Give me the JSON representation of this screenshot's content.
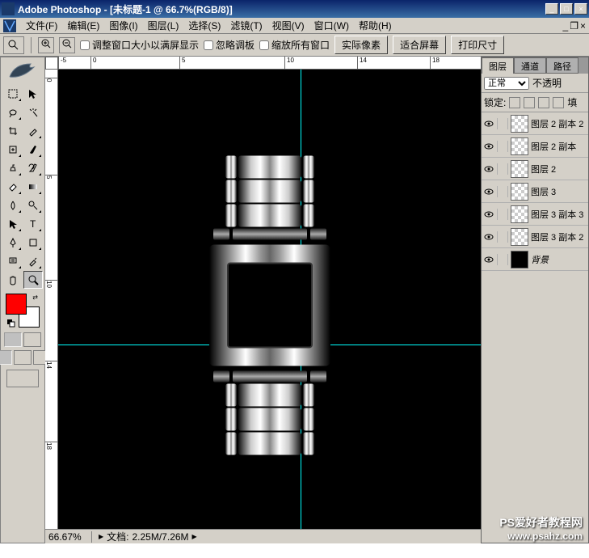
{
  "titlebar": {
    "app_name": "Adobe Photoshop",
    "doc_title": "[未标题-1 @ 66.7%(RGB/8)]",
    "separator": " - "
  },
  "menu": {
    "items": [
      "文件(F)",
      "编辑(E)",
      "图像(I)",
      "图层(L)",
      "选择(S)",
      "滤镜(T)",
      "视图(V)",
      "窗口(W)",
      "帮助(H)"
    ]
  },
  "optionbar": {
    "resize_windows": "调整窗口大小以满屏显示",
    "ignore_palettes": "忽略调板",
    "zoom_all": "缩放所有窗口",
    "actual_pixels": "实际像素",
    "fit_screen": "适合屏幕",
    "print_size": "打印尺寸"
  },
  "ruler_h_ticks": [
    "-5",
    "0",
    "5",
    "10",
    "14",
    "18"
  ],
  "ruler_v_ticks": [
    "0",
    "5",
    "10",
    "14",
    "18"
  ],
  "colors": {
    "foreground": "#ff0000",
    "background": "#ffffff"
  },
  "guides": {
    "v1": 300,
    "h1": 340
  },
  "status": {
    "zoom": "66.67%",
    "doc_label": "文档:",
    "doc_size": "2.25M/7.26M"
  },
  "panels": {
    "tabs": [
      "图层",
      "通道",
      "路径"
    ],
    "blend_mode": "正常",
    "opacity_label": "不透明",
    "lock_label": "锁定:",
    "fill_label": "填",
    "layers": [
      {
        "name": "图层 2 副本 2",
        "thumb": "checker"
      },
      {
        "name": "图层 2 副本",
        "thumb": "checker"
      },
      {
        "name": "图层 2",
        "thumb": "checker"
      },
      {
        "name": "图层 3",
        "thumb": "checker"
      },
      {
        "name": "图层 3 副本 3",
        "thumb": "checker"
      },
      {
        "name": "图层 3 副本 2",
        "thumb": "checker"
      },
      {
        "name": "背景",
        "thumb": "black",
        "bg": true
      }
    ]
  },
  "watermark": {
    "line1": "PS爱好者教程网",
    "line2": "www.psahz.com"
  },
  "tools": [
    "marquee",
    "move",
    "lasso",
    "magic-wand",
    "crop",
    "slice",
    "healing",
    "brush",
    "stamp",
    "history-brush",
    "eraser",
    "gradient",
    "blur",
    "dodge",
    "path-select",
    "type",
    "pen",
    "shape",
    "notes",
    "eyedropper",
    "hand",
    "zoom"
  ]
}
